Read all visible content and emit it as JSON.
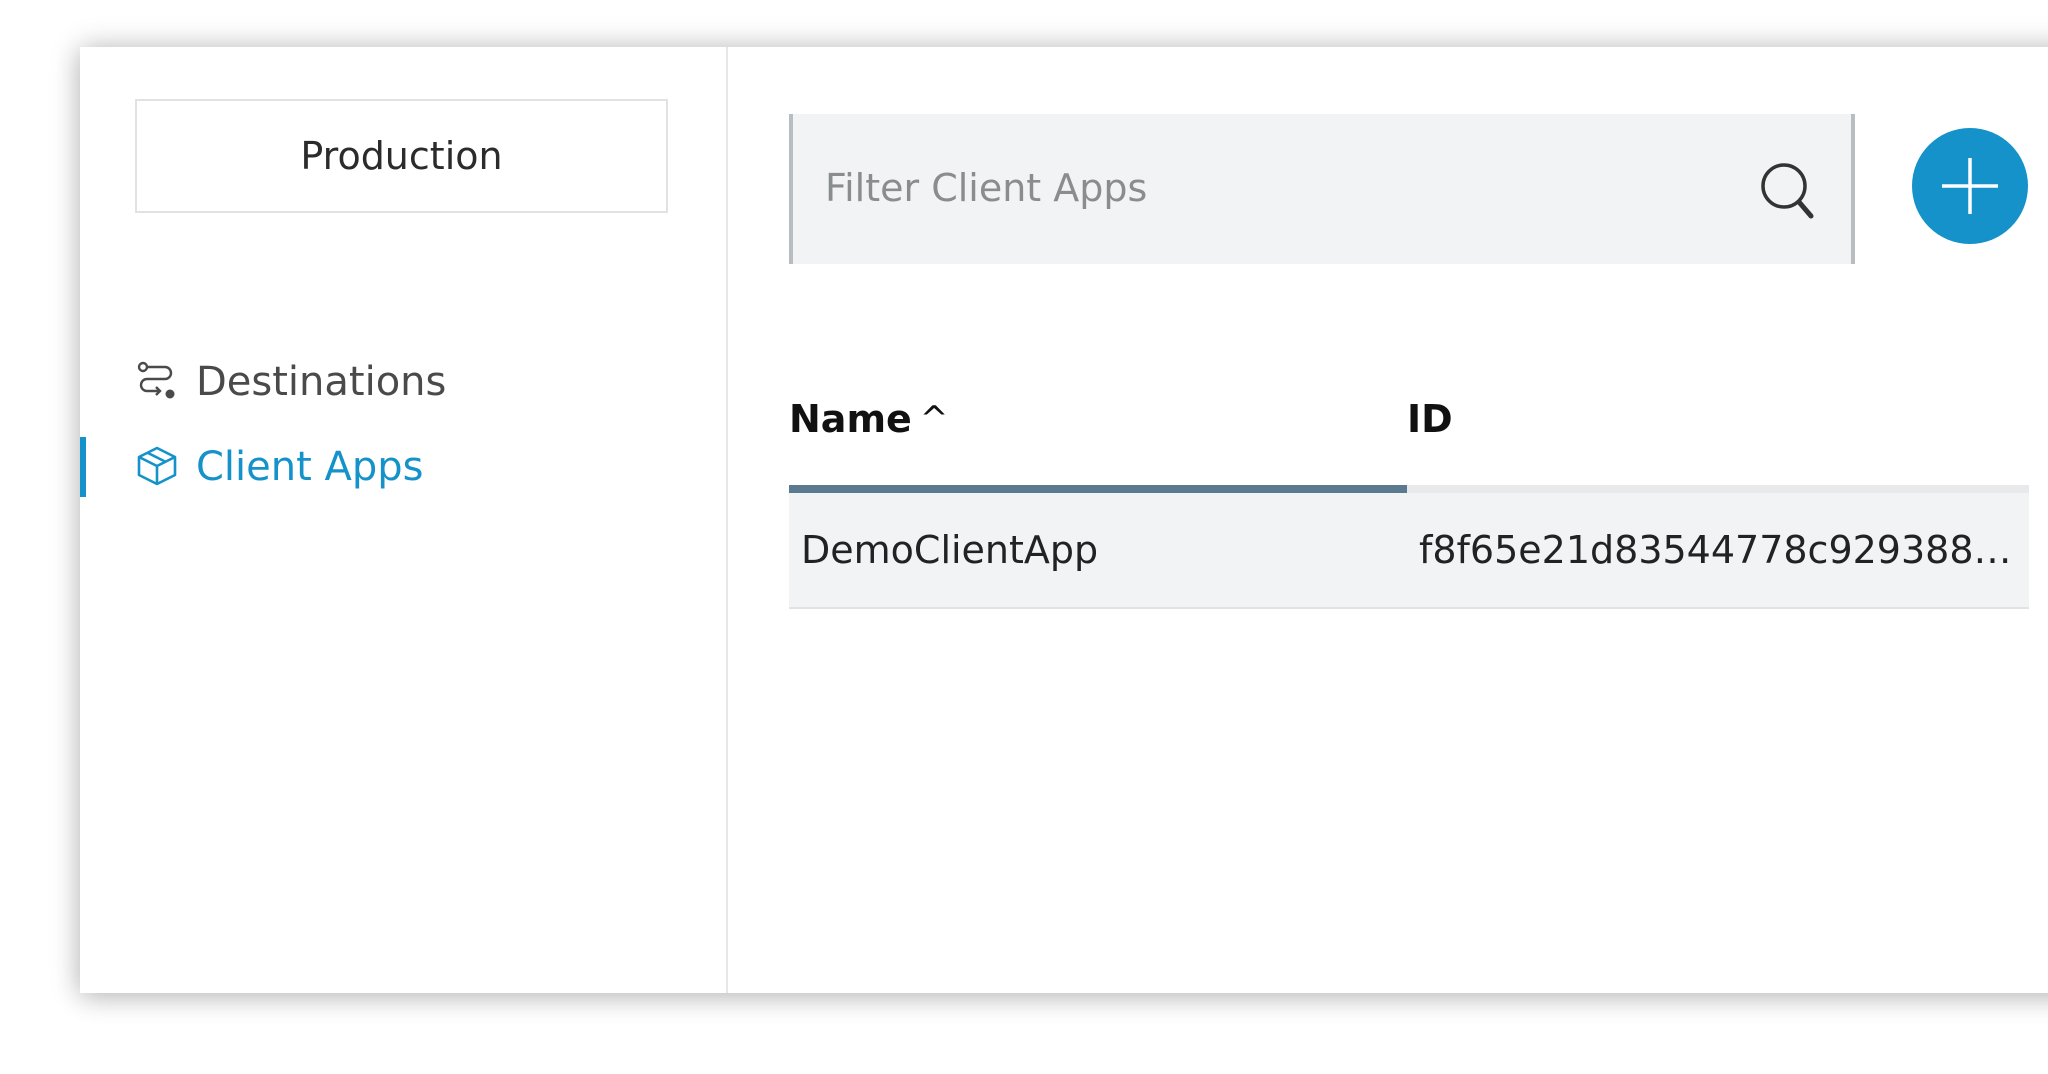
{
  "sidebar": {
    "environment": "Production",
    "items": [
      {
        "label": "Destinations",
        "icon": "route-icon",
        "active": false
      },
      {
        "label": "Client Apps",
        "icon": "box-icon",
        "active": true
      }
    ]
  },
  "main": {
    "search": {
      "placeholder": "Filter Client Apps",
      "value": ""
    },
    "table": {
      "columns": [
        "Name",
        "ID"
      ],
      "sort_indicator": "^",
      "rows": [
        {
          "name": "DemoClientApp",
          "id": "f8f65e21d83544778c9293889..."
        }
      ]
    }
  },
  "colors": {
    "accent": "#1592c9",
    "sort_underline": "#5c7a8f",
    "row_background": "#f2f3f4"
  }
}
